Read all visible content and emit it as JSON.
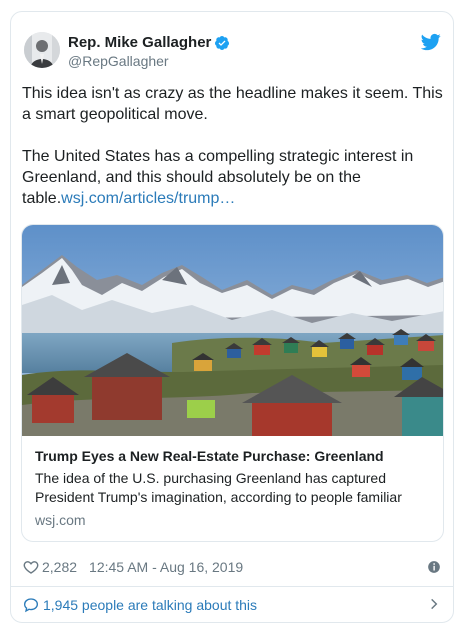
{
  "tweet": {
    "author_name": "Rep. Mike Gallagher",
    "author_handle": "@RepGallagher",
    "text_line1": "This idea isn't as crazy as the headline makes it seem. This a smart geopolitical move.",
    "text_line2": "The United States has a compelling strategic interest in Greenland, and this should absolutely be on the table.",
    "link_text": "wsj.com/articles/trump…",
    "icons": [
      "verified-badge-icon",
      "twitter-bird-icon",
      "heart-icon",
      "info-icon",
      "reply-bubble-icon",
      "chevron-right-icon"
    ]
  },
  "card": {
    "title": "Trump Eyes a New Real-Estate Purchase: Greenland",
    "description": "The idea of the U.S. purchasing Greenland has captured President Trump's imagination, according to people familiar",
    "domain": "wsj.com"
  },
  "meta": {
    "likes": "2,282",
    "timestamp": "12:45 AM - Aug 16, 2019"
  },
  "footer": {
    "talking": "1,945 people are talking about this"
  },
  "colors": {
    "link": "#2b7bb9",
    "twitter_blue": "#1da1f2",
    "secondary_text": "#697882",
    "border": "#e1e8ed"
  }
}
